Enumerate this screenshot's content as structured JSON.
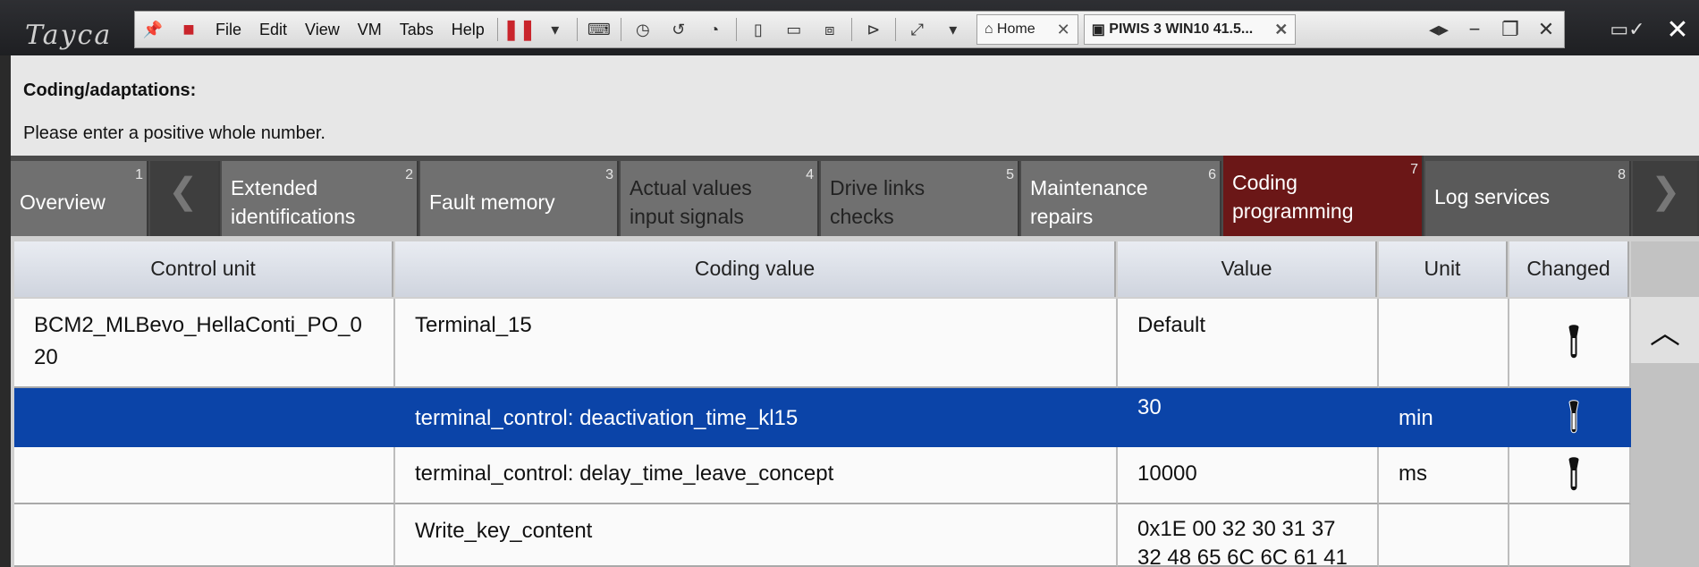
{
  "brand": "Tayca",
  "vm_menu": [
    "File",
    "Edit",
    "View",
    "VM",
    "Tabs",
    "Help"
  ],
  "vm_tabs": [
    {
      "label": "Home"
    },
    {
      "label": "PIWIS 3 WIN10 41.5..."
    }
  ],
  "header": {
    "title": "Coding/adaptations:",
    "message": "Please enter a positive whole number."
  },
  "tabs": [
    {
      "num": "1",
      "line1": "Overview",
      "line2": ""
    },
    {
      "num": "2",
      "line1": "Extended",
      "line2": "identifications"
    },
    {
      "num": "3",
      "line1": "Fault memory",
      "line2": ""
    },
    {
      "num": "4",
      "line1": "Actual values",
      "line2": "input signals"
    },
    {
      "num": "5",
      "line1": "Drive links",
      "line2": "checks"
    },
    {
      "num": "6",
      "line1": "Maintenance",
      "line2": "repairs"
    },
    {
      "num": "7",
      "line1": "Coding",
      "line2": "programming"
    },
    {
      "num": "8",
      "line1": "Log services",
      "line2": ""
    }
  ],
  "columns": {
    "control_unit": "Control unit",
    "coding_value": "Coding value",
    "value": "Value",
    "unit": "Unit",
    "changed": "Changed"
  },
  "rows": [
    {
      "control_unit_1": "BCM2_MLBevo_HellaConti_PO_0",
      "control_unit_2": "20",
      "coding_value": "Terminal_15",
      "value": "Default",
      "unit": ""
    },
    {
      "control_unit_1": "",
      "control_unit_2": "",
      "coding_value": "terminal_control: deactivation_time_kl15",
      "value": "30",
      "unit": "min"
    },
    {
      "control_unit_1": "",
      "control_unit_2": "",
      "coding_value": "terminal_control: delay_time_leave_concept",
      "value": "10000",
      "unit": "ms"
    },
    {
      "control_unit_1": "",
      "control_unit_2": "",
      "coding_value": "Write_key_content",
      "value_1": "0x1E 00 32 30 31 37",
      "value_2": "32 48 65 6C 6C 61 41",
      "unit": ""
    }
  ],
  "colors": {
    "selected_row": "#0b44a8",
    "active_tab": "#6b1717"
  }
}
